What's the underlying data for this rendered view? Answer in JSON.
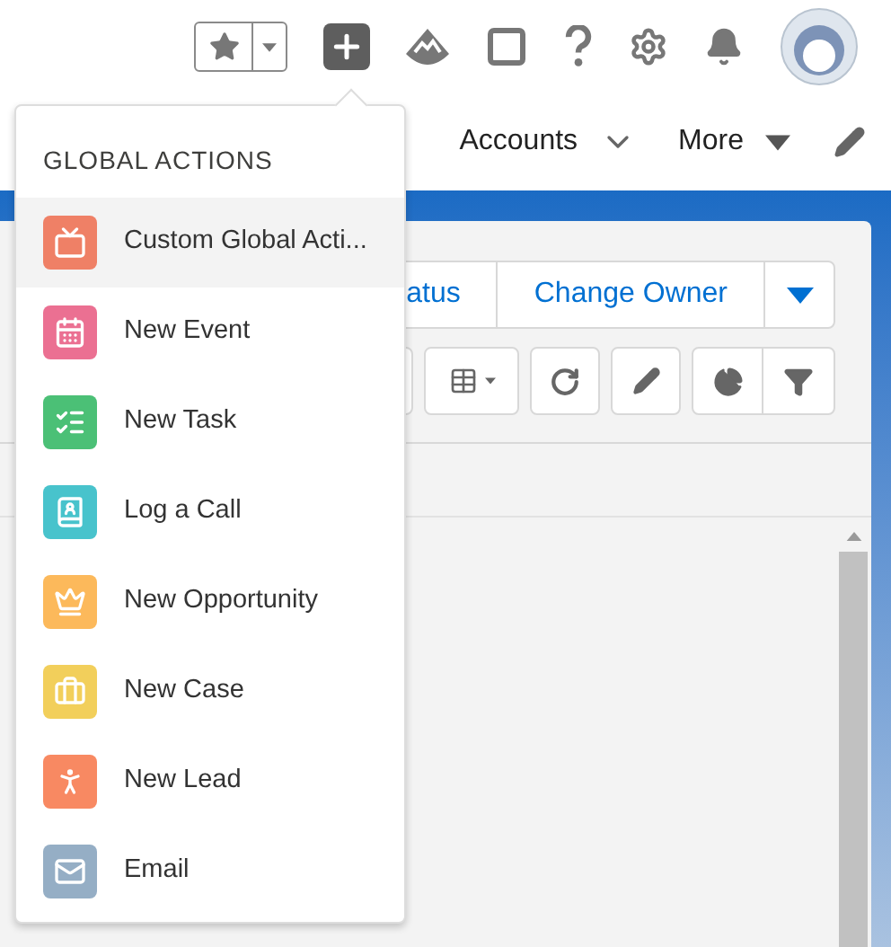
{
  "nav": [
    {
      "label": "Accounts",
      "kind": "chevron"
    },
    {
      "label": "More",
      "kind": "caret"
    }
  ],
  "actions_bar": {
    "buttons": [
      "atus",
      "Change Owner"
    ]
  },
  "menu": {
    "title": "GLOBAL ACTIONS",
    "items": [
      {
        "label": "Custom Global Acti...",
        "kind": "tv",
        "color": "#ef8066",
        "selected": true
      },
      {
        "label": "New Event",
        "kind": "calendar",
        "color": "#eb7092",
        "selected": false
      },
      {
        "label": "New Task",
        "kind": "task",
        "color": "#4bc076",
        "selected": false
      },
      {
        "label": "Log a Call",
        "kind": "call",
        "color": "#48c3cc",
        "selected": false
      },
      {
        "label": "New Opportunity",
        "kind": "crown",
        "color": "#fcb95b",
        "selected": false
      },
      {
        "label": "New Case",
        "kind": "case",
        "color": "#f2cf5b",
        "selected": false
      },
      {
        "label": "New Lead",
        "kind": "lead",
        "color": "#f88962",
        "selected": false
      },
      {
        "label": "Email",
        "kind": "email",
        "color": "#95aec5",
        "selected": false
      }
    ]
  }
}
